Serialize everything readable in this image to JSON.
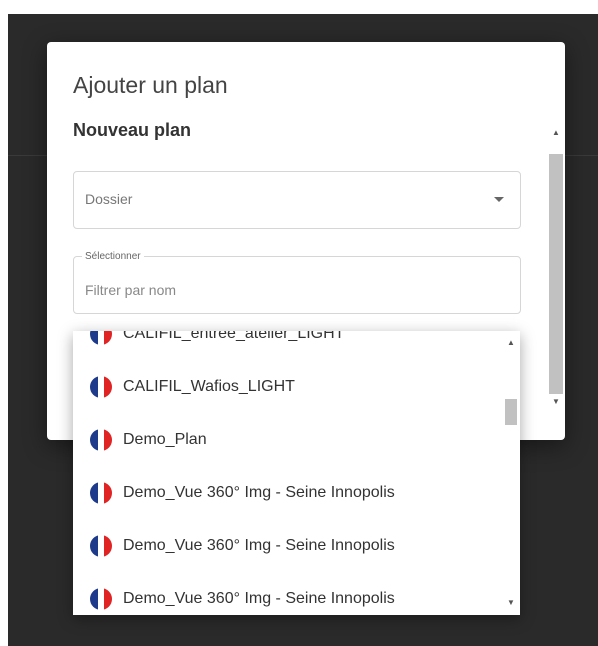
{
  "dialog": {
    "title": "Ajouter un plan",
    "section_title": "Nouveau plan"
  },
  "form": {
    "dossier_label": "Dossier",
    "filter_legend": "Sélectionner",
    "filter_placeholder": "Filtrer par nom",
    "filter_value": ""
  },
  "dropdown": {
    "items": [
      {
        "label": "CALIFIL_entree_atelier_LIGHT",
        "flag": "fr-flag-icon"
      },
      {
        "label": "CALIFIL_Wafios_LIGHT",
        "flag": "fr-flag-icon"
      },
      {
        "label": "Demo_Plan",
        "flag": "fr-flag-icon"
      },
      {
        "label": "Demo_Vue 360° Img - Seine Innopolis",
        "flag": "fr-flag-icon"
      },
      {
        "label": "Demo_Vue 360° Img - Seine Innopolis",
        "flag": "fr-flag-icon"
      },
      {
        "label": "Demo_Vue 360° Img - Seine Innopolis",
        "flag": "fr-flag-icon"
      }
    ]
  },
  "icons": {
    "scroll_up": "▲",
    "scroll_down": "▼"
  },
  "colors": {
    "backdrop": "#2a2a2a",
    "flag_blue": "#1e3a8a",
    "flag_red": "#e02424"
  }
}
